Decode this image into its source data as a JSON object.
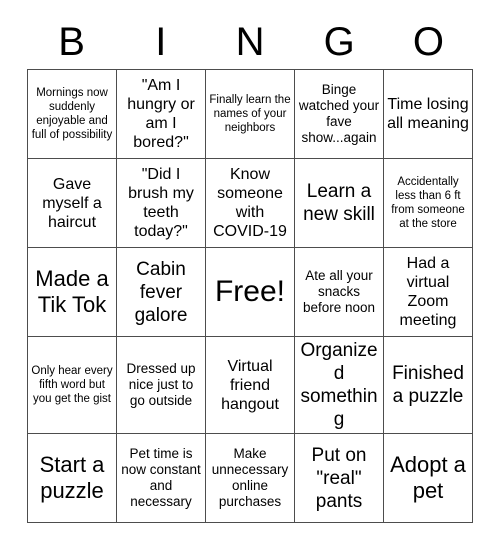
{
  "card": {
    "header_letters": [
      "B",
      "I",
      "N",
      "G",
      "O"
    ],
    "free_space_label": "Free!",
    "border_color": "#4d4d4d",
    "text_color": "#000000",
    "background_color": "#ffffff",
    "rows": [
      [
        "Mornings now suddenly enjoyable and full of possibility",
        "\"Am I hungry or am I bored?\"",
        "Finally learn the names of your neighbors",
        "Binge watched your fave show...again",
        "Time losing all meaning"
      ],
      [
        "Gave myself a haircut",
        "\"Did I brush my teeth today?\"",
        "Know someone with COVID-19",
        "Learn a new skill",
        "Accidentally less than 6 ft from someone at the store"
      ],
      [
        "Made a Tik Tok",
        "Cabin fever galore",
        "Free!",
        "Ate all your snacks before noon",
        "Had a virtual Zoom meeting"
      ],
      [
        "Only hear every fifth word but you get the gist",
        "Dressed up nice just to go outside",
        "Virtual friend hangout",
        "Organized something",
        "Finished a puzzle"
      ],
      [
        "Start a puzzle",
        "Pet time is now constant and necessary",
        "Make unnecessary online purchases",
        "Put on \"real\" pants",
        "Adopt a pet"
      ]
    ]
  }
}
